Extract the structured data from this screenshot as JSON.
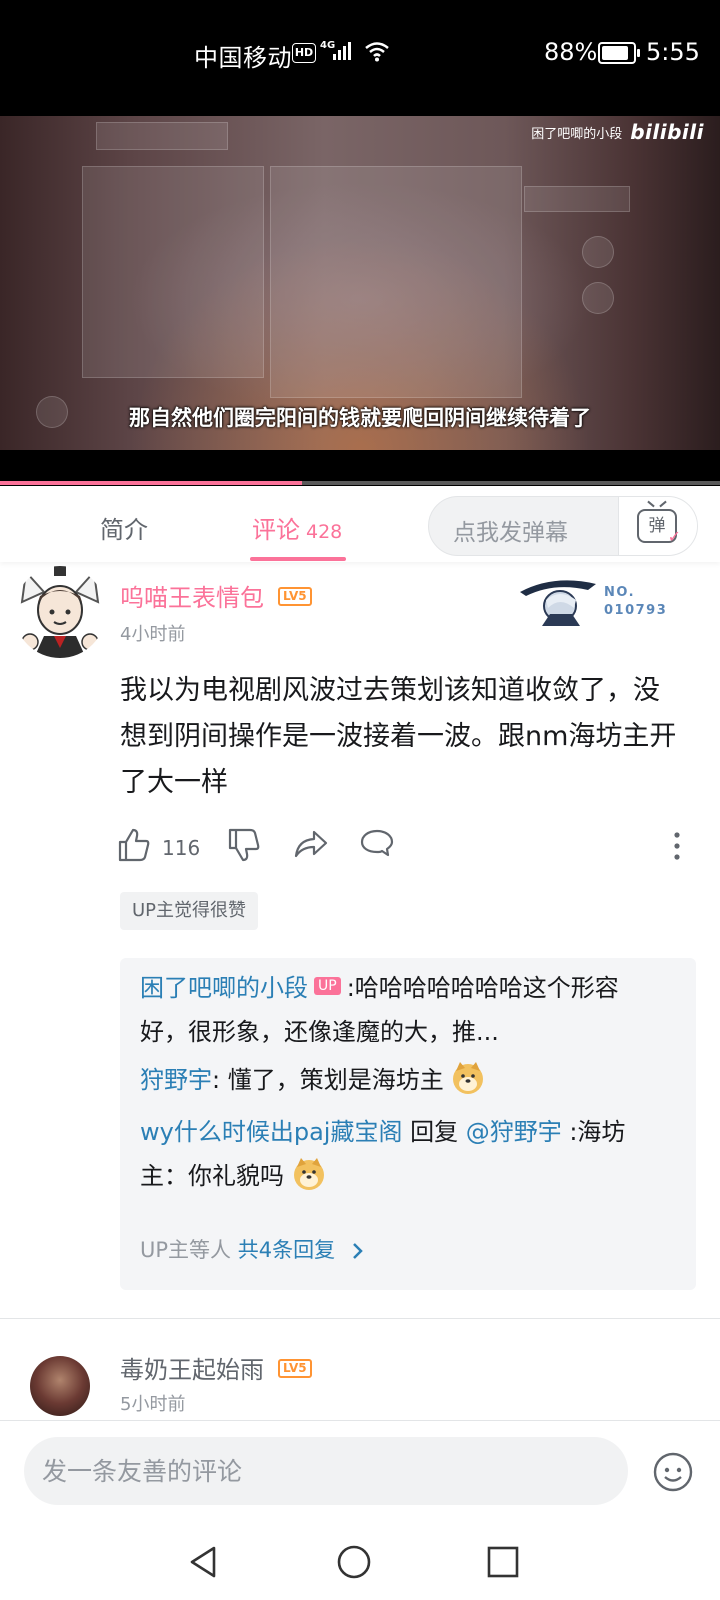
{
  "status_bar": {
    "carrier": "中国移动",
    "hd": "HD",
    "network": "4G",
    "battery": "88%",
    "time": "5:55"
  },
  "video": {
    "watermark_text": "困了吧唧的小段",
    "watermark_logo": "bilibili",
    "subtitle": "那自然他们圈完阳间的钱就要爬回阴间继续待着了",
    "progress": 0.42
  },
  "tabs": {
    "intro": "简介",
    "comments": "评论",
    "comments_count": "428",
    "danmaku_placeholder": "点我发弹幕",
    "danmaku_icon_char": "弹"
  },
  "comment1": {
    "username": "呜喵王表情包",
    "level": "LV5",
    "time": "4小时前",
    "fan_badge_no": "NO.",
    "fan_badge_num": "010793",
    "content": "我以为电视剧风波过去策划该知道收敛了，没想到阴间操作是一波接着一波。跟nm海坊主开了大一样",
    "likes": "116",
    "up_liked": "UP主觉得很赞",
    "replies": [
      {
        "user": "困了吧唧的小段",
        "tag": "UP",
        "text": ":哈哈哈哈哈哈哈这个形容好，很形象，还像逢魔的大，推..."
      },
      {
        "user": "狩野宇",
        "text": ": 懂了，策划是海坊主"
      },
      {
        "user": "wy什么时候出paj藏宝阁",
        "mid": " 回复 ",
        "mention": "@狩野宇",
        "text": " :海坊主：你礼貌吗"
      }
    ],
    "reply_summary_prefix": "UP主等人 ",
    "reply_summary_link": "共4条回复"
  },
  "comment2": {
    "username": "毒奶王起始雨",
    "level": "LV5",
    "time": "5小时前"
  },
  "input": {
    "placeholder": "发一条友善的评论"
  },
  "colors": {
    "accent": "#fb7299",
    "link": "#2b7fb5",
    "level": "#ff9433"
  },
  "icons": [
    "signal-icon",
    "wifi-icon",
    "battery-icon",
    "danmaku-icon",
    "like-icon",
    "dislike-icon",
    "share-icon",
    "reply-icon",
    "more-icon",
    "chevron-right-icon",
    "emoji-icon",
    "back-icon",
    "home-icon",
    "recents-icon"
  ]
}
